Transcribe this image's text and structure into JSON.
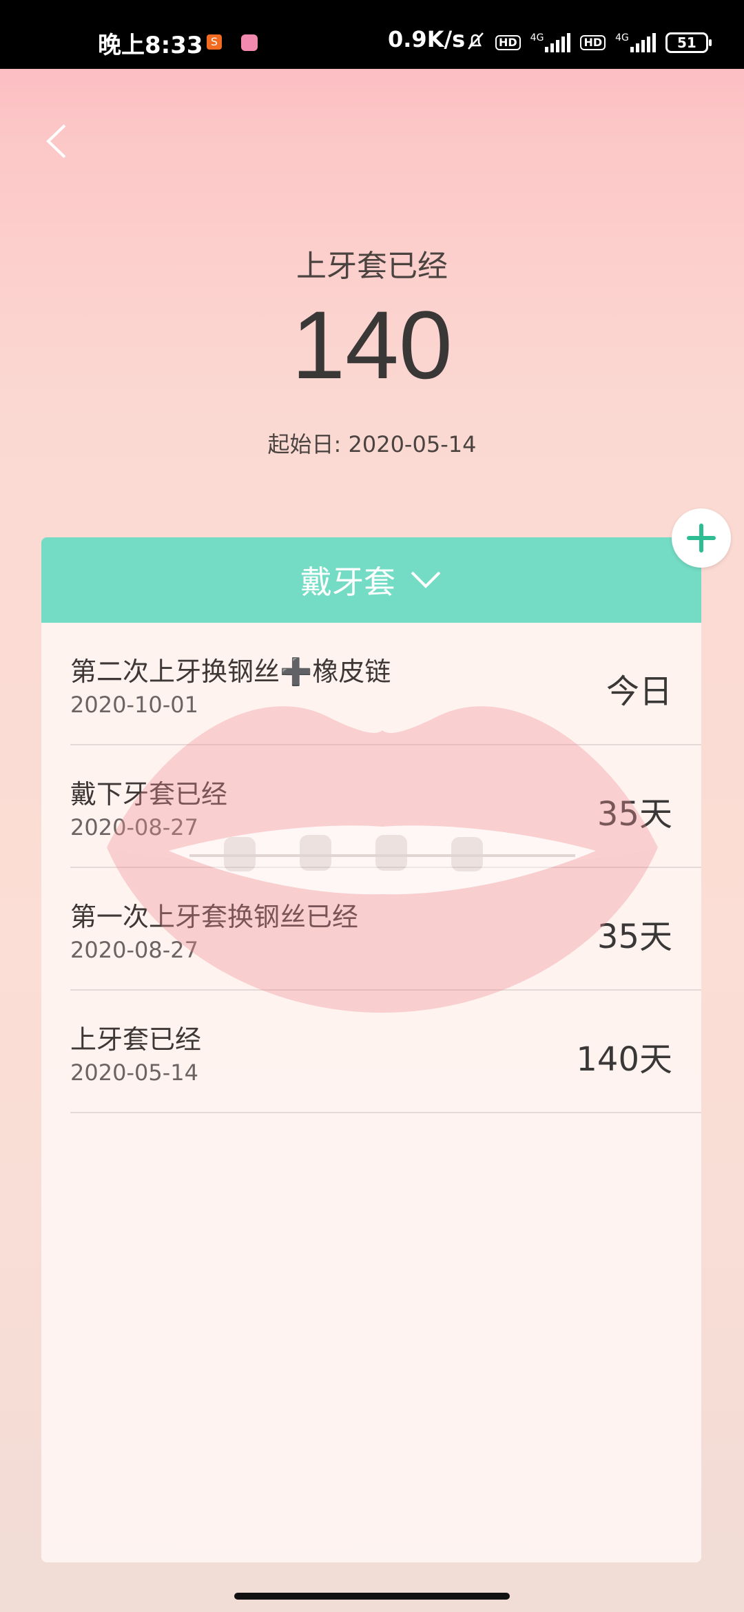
{
  "status_bar": {
    "time": "晚上8:33",
    "app1": "S",
    "network_speed": "0.9K/s",
    "hd1": "HD",
    "net1": "4G",
    "hd2": "HD",
    "net2": "4G",
    "battery": "51"
  },
  "header": {
    "label": "上牙套已经",
    "count": "140",
    "start_date": "起始日: 2020-05-14"
  },
  "card": {
    "title": "戴牙套",
    "items": [
      {
        "title": "第二次上牙换钢丝➕橡皮链",
        "date": "2020-10-01",
        "value": "今日"
      },
      {
        "title": "戴下牙套已经",
        "date": "2020-08-27",
        "value": "35天"
      },
      {
        "title": "第一次上牙套换钢丝已经",
        "date": "2020-08-27",
        "value": "35天"
      },
      {
        "title": "上牙套已经",
        "date": "2020-05-14",
        "value": "140天"
      }
    ]
  },
  "colors": {
    "accent": "#74dcc4",
    "text_dark": "#3a3837"
  }
}
